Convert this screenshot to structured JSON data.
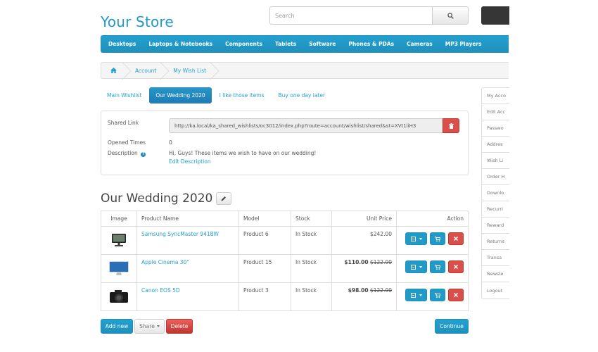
{
  "store": {
    "name": "Your Store"
  },
  "search": {
    "placeholder": "Search"
  },
  "menu": [
    "Desktops",
    "Laptops & Notebooks",
    "Components",
    "Tablets",
    "Software",
    "Phones & PDAs",
    "Cameras",
    "MP3 Players"
  ],
  "breadcrumb": [
    "Account",
    "My Wish List"
  ],
  "tabs": [
    "Main Wishlist",
    "Our Wedding 2020",
    "I like those items",
    "Buy one day later"
  ],
  "panel": {
    "shared_link_label": "Shared Link",
    "shared_link_value": "http://ka.local/ka_shared_wishlists/oc3012/index.php?route=account/wishlist/shared&st=XVt1liH3",
    "opened_label": "Opened Times",
    "opened_value": "0",
    "description_label": "Description",
    "description_value": "Hi, Guys! These items we wish to have on our wedding!",
    "edit_description": "Edit Description"
  },
  "wishlist_title": "Our Wedding 2020",
  "table": {
    "headers": [
      "Image",
      "Product Name",
      "Model",
      "Stock",
      "Unit Price",
      "Action"
    ],
    "rows": [
      {
        "name": "Samsung SyncMaster 941BW",
        "model": "Product 6",
        "stock": "In Stock",
        "price": "$242.00",
        "old_price": ""
      },
      {
        "name": "Apple Cinema 30\"",
        "model": "Product 15",
        "stock": "In Stock",
        "price": "$110.00",
        "old_price": "$122.00"
      },
      {
        "name": "Canon EOS 5D",
        "model": "Product 3",
        "stock": "In Stock",
        "price": "$98.00",
        "old_price": "$122.00"
      }
    ]
  },
  "buttons": {
    "add_new": "Add new",
    "share": "Share",
    "delete": "Delete",
    "continue": "Continue"
  },
  "sidebar": [
    "My Acco",
    "Edit Acc",
    "Passwo",
    "Addres",
    "Wish Li",
    "Order H",
    "Downlo",
    "Recurri",
    "Reward",
    "Returns",
    "Transa",
    "Newsle",
    "Logout"
  ],
  "colors": {
    "accent": "#229ac8",
    "danger": "#da4f49",
    "cart": "#363636"
  }
}
